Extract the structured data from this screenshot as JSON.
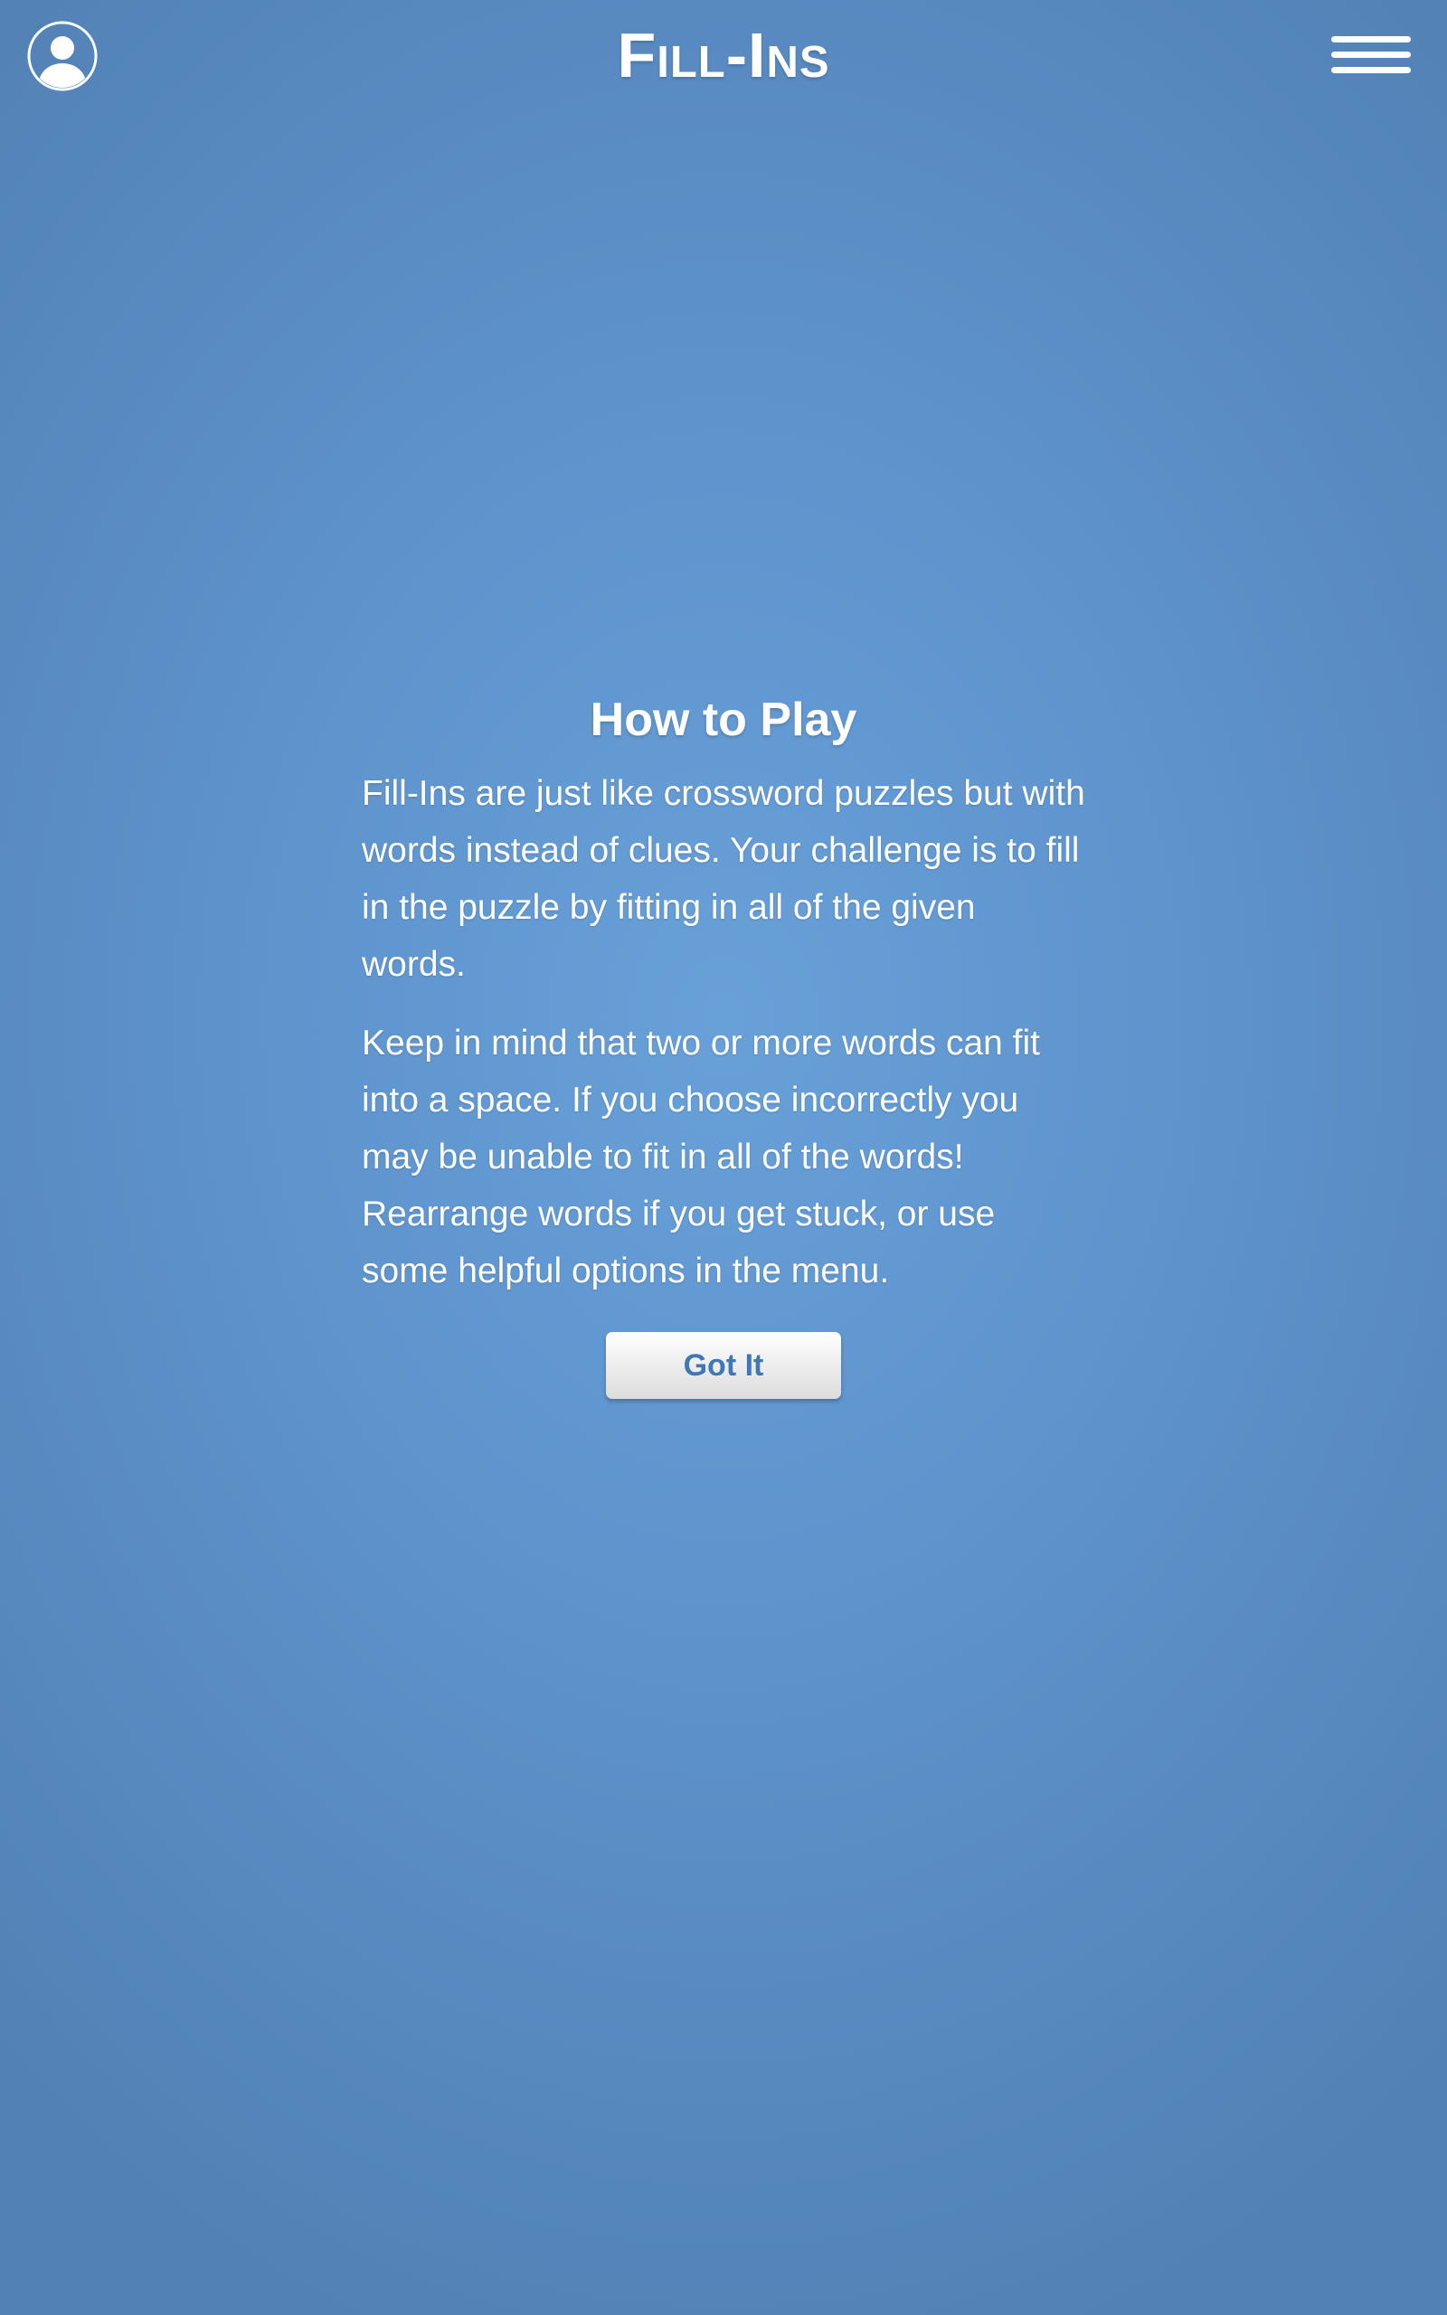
{
  "header": {
    "title": "Fill-Ins",
    "profile_icon": "user-circle-icon",
    "menu_icon": "hamburger-menu-icon"
  },
  "dialog": {
    "title": "How to Play",
    "paragraphs": [
      "Fill-Ins are just like crossword puzzles but with words instead of clues. Your challenge is to fill in the puzzle by fitting in all of the given words.",
      "Keep in mind that two or more words can fit into a space. If you choose incorrectly you may be unable to fit in all of the words! Rearrange words if you get stuck, or use some helpful options in the menu."
    ],
    "button_label": "Got It"
  },
  "colors": {
    "background_center": "#68a0d8",
    "background_edge": "#5281b5",
    "button_text": "#3f78b5",
    "text": "#ffffff"
  }
}
